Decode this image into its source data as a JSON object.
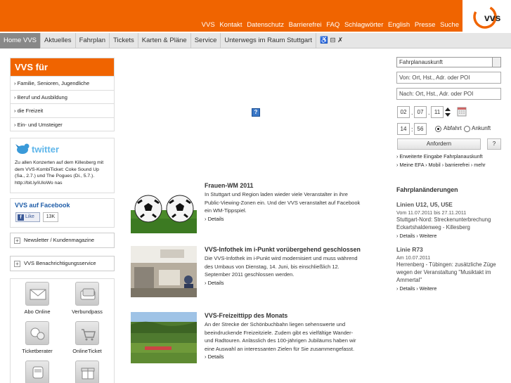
{
  "colors": {
    "brand_orange": "#f06400",
    "nav_bg": "#e6e6e6",
    "nav_active": "#888888",
    "facebook_blue": "#1f5da8"
  },
  "header": {
    "links": [
      "VVS",
      "Kontakt",
      "Datenschutz",
      "Barrierefrei",
      "FAQ",
      "Schlagwörter",
      "English",
      "Presse",
      "Suche"
    ],
    "logo_text": "vvs"
  },
  "nav": {
    "items": [
      "Home VVS",
      "Aktuelles",
      "Fahrplan",
      "Tickets",
      "Karten & Pläne",
      "Service",
      "Unterwegs im Raum Stuttgart",
      "♿ ⊟ ✗"
    ]
  },
  "left": {
    "vvs_fuer_title": "VVS für",
    "vvs_fuer_items": [
      "› Familie, Senioren, Jugendliche",
      "› Beruf und Ausbildung",
      "› die Freizeit",
      "› Ein- und Umsteiger"
    ],
    "twitter_logo": "twitter",
    "twitter_text": "Zu allen Konzerten auf dem Killesberg mit dem VVS-KombiTicket: Coke Sound Up (Sa., 2.7.) und The Pogues (Di., 5.7.). http://bit.ly/iUloWo nas",
    "facebook_title": "VVS auf Facebook",
    "facebook_like": "Like",
    "facebook_count": "13K",
    "accordion_1": "Newsletter / Kundenmagazine",
    "accordion_2": "VVS Benachrichtigungsservice",
    "services": [
      "Abo Online",
      "Verbundpass",
      "Ticketberater",
      "OnlineTicket",
      "",
      ""
    ]
  },
  "news": [
    {
      "title": "Frauen-WM 2011",
      "text": "In Stuttgart und Region laden wieder viele Veranstalter in ihre Public-Viewing-Zonen ein. Und der VVS veranstaltet auf Facebook ein WM-Tippspiel.",
      "more": "› Details"
    },
    {
      "title": "VVS-Infothek im i-Punkt vorübergehend geschlossen",
      "text": "Die VVS-Infothek im i-Punkt wird modernisiert und muss während des Umbaus von Dienstag, 14. Juni, bis einschließlich 12. September 2011 geschlossen werden.",
      "more": "› Details"
    },
    {
      "title": "VVS-Freizeittipp des Monats",
      "text": "An der Strecke der Schönbuchbahn liegen sehenswerte und beeindruckende Freizeitziele. Zudem gibt es vielfältige Wander- und Radtouren. Anlässlich des 100-jährigen Jubiläums haben wir eine Auswahl an interessanten Zielen für Sie zusammengefasst.",
      "more": "› Details"
    }
  ],
  "planner": {
    "select_value": "Fahrplanauskunft",
    "from_placeholder": "Von: Ort, Hst., Adr. oder POI",
    "to_placeholder": "Nach: Ort, Hst., Adr. oder POI",
    "day": "02",
    "month": "07",
    "year": "11",
    "hour": "14",
    "minute": "56",
    "departure_label": "Abfahrt",
    "arrival_label": "Ankunft",
    "submit_label": "Anfordern",
    "help_label": "?",
    "link_extended": "› Erweiterte Eingabe Fahrplanauskunft",
    "link_mobile": "› Meine EFA  › Mobil  › barrierefrei  › mehr"
  },
  "changes": {
    "title": "Fahrplanänderungen",
    "items": [
      {
        "title": "Linien U12, U5, U5E",
        "date": "Vom 11.07.2011 bis 27.11.2011",
        "text": "Stuttgart-Nord: Streckenunterbrechung Eckartshaldenweg - Killesberg",
        "links": "› Details   › Weitere"
      },
      {
        "title": "Linie R73",
        "date": "Am 10.07.2011",
        "text": "Herrenberg - Tübingen: zusätzliche Züge wegen der Veranstaltung \"Musiktakt im Ammertal\"",
        "links": "› Details   › Weitere"
      }
    ]
  }
}
